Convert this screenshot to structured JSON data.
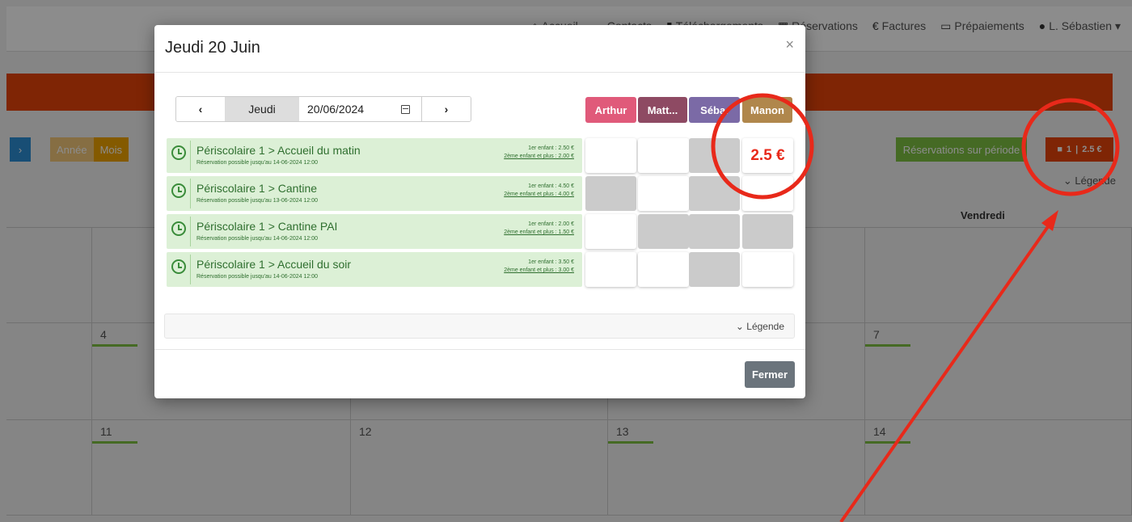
{
  "nav": {
    "links": [
      {
        "icon": "home-icon",
        "label": "Accueil"
      },
      {
        "icon": "contact-icon",
        "label": "Contacts"
      },
      {
        "icon": "download-icon",
        "label": "Téléchargements"
      },
      {
        "icon": "calendar-icon",
        "label": "Réservations"
      },
      {
        "icon": "euro-icon",
        "label": "Factures"
      },
      {
        "icon": "card-icon",
        "label": "Prépaiements"
      },
      {
        "icon": "user-icon",
        "label": "L. Sébastien"
      }
    ]
  },
  "toolbar": {
    "next": "›",
    "view_year": "Année",
    "view_month": "Mois",
    "resa_periode": "Réservations sur période",
    "cart_count": "1",
    "cart_amount": "2.5 €",
    "legend": "Légende"
  },
  "calendar": {
    "visible_day": "Vendredi",
    "days": [
      "4",
      "7",
      "11",
      "12",
      "13",
      "14"
    ]
  },
  "modal": {
    "title": "Jeudi 20 Juin",
    "close": "×",
    "prev": "‹",
    "day_name": "Jeudi",
    "date": "20/06/2024",
    "next": "›",
    "children": [
      {
        "name": "Arthur",
        "color": "#e05a7a"
      },
      {
        "name": "Matt...",
        "color": "#8e4a63"
      },
      {
        "name": "Séba.",
        "color": "#7b6aa6"
      },
      {
        "name": "Manon",
        "color": "#b0874c"
      }
    ],
    "services": [
      {
        "name": "Périscolaire 1 > Accueil du matin",
        "deadline": "Réservation possible jusqu'au 14-06-2024 12:00",
        "price1": "1er enfant : 2.50 €",
        "price2": "2ème enfant et plus : 2.00 €",
        "slots": [
          "open",
          "open",
          "disabled",
          "selected"
        ]
      },
      {
        "name": "Périscolaire 1 > Cantine",
        "deadline": "Réservation possible jusqu'au 13-06-2024 12:00",
        "price1": "1er enfant : 4.50 €",
        "price2": "2ème enfant et plus : 4.00 €",
        "slots": [
          "disabled",
          "open",
          "disabled",
          "open"
        ]
      },
      {
        "name": "Périscolaire 1 > Cantine PAI",
        "deadline": "Réservation possible jusqu'au 14-06-2024 12:00",
        "price1": "1er enfant : 2.00 €",
        "price2": "2ème enfant et plus : 1.50 €",
        "slots": [
          "open",
          "disabled",
          "disabled",
          "disabled"
        ]
      },
      {
        "name": "Périscolaire 1 > Accueil du soir",
        "deadline": "Réservation possible jusqu'au 14-06-2024 12:00",
        "price1": "1er enfant : 3.50 €",
        "price2": "2ème enfant et plus : 3.00 €",
        "slots": [
          "open",
          "open",
          "disabled",
          "open"
        ]
      }
    ],
    "selected_price": "2.5 €",
    "legend": "Légende",
    "close_button": "Fermer"
  },
  "colors": {
    "accent_orange": "#e8440a",
    "annotation_red": "#e8291a",
    "service_bg": "#dcf0d6"
  }
}
